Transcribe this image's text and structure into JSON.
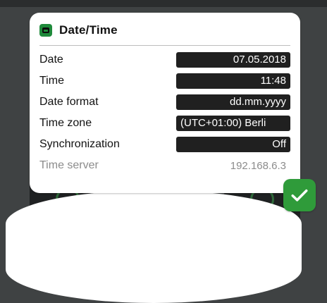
{
  "dialog": {
    "title": "Date/Time",
    "icon": "calendar-icon",
    "rows": [
      {
        "label": "Date",
        "value": "07.05.2018",
        "enabled": true
      },
      {
        "label": "Time",
        "value": "11:48",
        "enabled": true
      },
      {
        "label": "Date format",
        "value": "dd.mm.yyyy",
        "enabled": true
      },
      {
        "label": "Time zone",
        "value": "(UTC+01:00) Berli",
        "enabled": true
      },
      {
        "label": "Synchronization",
        "value": "Off",
        "enabled": true
      },
      {
        "label": "Time server",
        "value": "192.168.6.3",
        "enabled": false
      }
    ]
  },
  "confirm_button": {
    "icon": "checkmark-icon",
    "color": "#2f9b3a"
  },
  "colors": {
    "app_icon": "#1f8a3b",
    "value_box": "#202020",
    "disabled_text": "#8c8c8c"
  }
}
